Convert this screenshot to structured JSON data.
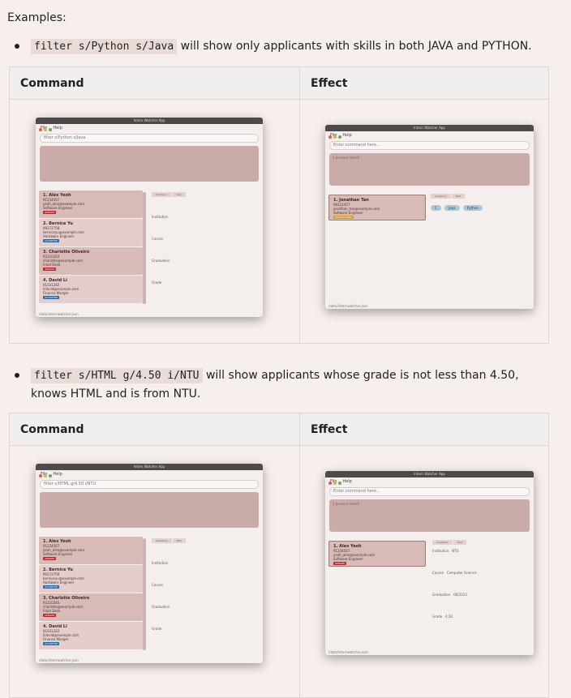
{
  "intro": "Examples:",
  "examples": [
    {
      "code": "filter s/Python s/Java",
      "text": " will show only applicants with skills in both JAVA and PYTHON.",
      "header_command": "Command",
      "header_effect": "Effect"
    },
    {
      "code": "filter s/HTML g/4.50 i/NTU",
      "text": " will show applicants whose grade is not less than 4.50, knows HTML and is from NTU.",
      "header_command": "Command",
      "header_effect": "Effect"
    }
  ],
  "app": {
    "title": "Intern Watcher App",
    "menu_file": "File",
    "menu_help": "Help",
    "cmd_placeholder": "Enter command here...",
    "cmd1": "filter s/Python s/Java",
    "cmd2": "filter s/HTML g/4.50 i/NTU",
    "result_listed": "1 persons listed!",
    "footer": "/data/internwatcher.json",
    "tab_academic": "Academic",
    "tab_skill": "Skill",
    "field_institution": "Institution",
    "field_course": "Course",
    "field_graduation": "Graduation",
    "field_grade": "Grade",
    "people": [
      {
        "name": "1. Alex Yeoh",
        "phone": "91234567",
        "email": "yeoh_alex@example.com",
        "role": "Software Engineer",
        "status": "APPLIED",
        "color": "#c0202a"
      },
      {
        "name": "2. Bernice Yu",
        "phone": "99272758",
        "email": "berniceyu@example.com",
        "role": "Hardware Engineer",
        "status": "ACCEPTED",
        "color": "#1d6fb0"
      },
      {
        "name": "3. Charlotte Oliveiro",
        "phone": "93210283",
        "email": "charlotte@example.com",
        "role": "Front Desk",
        "status": "APPLIED",
        "color": "#c0202a"
      },
      {
        "name": "4. David Li",
        "phone": "91031282",
        "email": "lidavid@example.com",
        "role": "Finance Manger",
        "status": "ACCEPTED",
        "color": "#1d6fb0"
      }
    ],
    "jonathan": {
      "name": "1. Jonathan Tan",
      "phone": "98123457",
      "email": "jonathan_tan@example.com",
      "role": "Software Engineer",
      "status": "SHORTLISTED",
      "color": "#d69a20"
    },
    "skills": [
      "C",
      "Java",
      "Python"
    ],
    "alex_detail": {
      "institution": "NTU",
      "course": "Computer Science",
      "graduation": "06/2023",
      "grade": "4.50"
    }
  }
}
